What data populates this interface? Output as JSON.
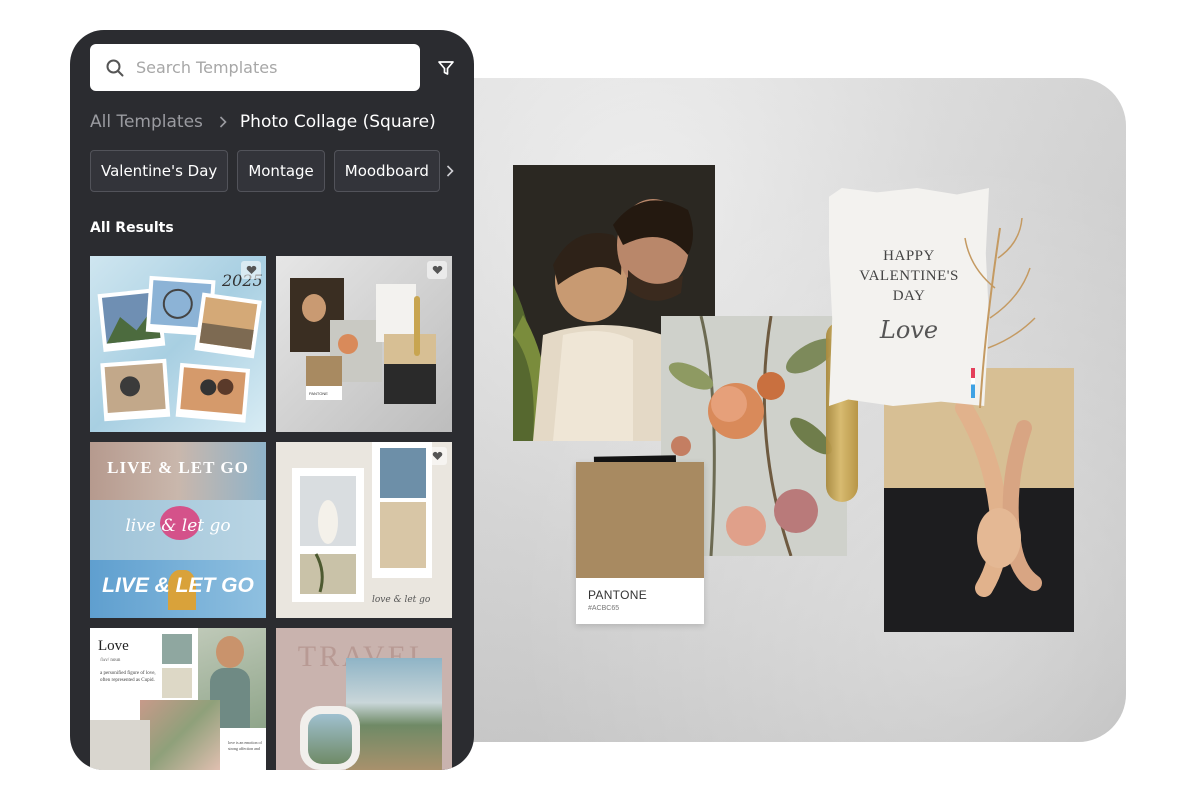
{
  "search": {
    "placeholder": "Search Templates"
  },
  "breadcrumb": {
    "root": "All Templates",
    "current": "Photo Collage (Square)"
  },
  "chips": [
    "Valentine's Day",
    "Montage",
    "Moodboard"
  ],
  "results_title": "All Results",
  "thumbnails": [
    {
      "name": "winter-travel-collage",
      "text": "2025"
    },
    {
      "name": "valentine-moodboard-mini",
      "text": "PANTONE"
    },
    {
      "name": "live-and-let-go",
      "lines": [
        "LIVE & LET GO",
        "live & let go",
        "LIVE & LET GO"
      ]
    },
    {
      "name": "film-strip-beach",
      "text": "love & let go"
    },
    {
      "name": "love-editorial",
      "title": "Love",
      "subtitle": "/lʌv/ noun",
      "body": "a personified figure of love, often represented as Cupid.",
      "caption": "love is an emotion of strong affection and"
    },
    {
      "name": "travel-collage",
      "text": "TRAVEL"
    }
  ],
  "canvas": {
    "card_lines": [
      "HAPPY",
      "VALENTINE'S",
      "DAY"
    ],
    "card_script": "Love",
    "pantone_label": "PANTONE",
    "pantone_code": "#ACBC65",
    "pantone_color": "#A88A61"
  },
  "colors": {
    "sidebar_bg": "#2B2C30",
    "chip_bg": "#33343A",
    "accent_text": "#FFFFFF",
    "muted_text": "#9A9BA0"
  }
}
